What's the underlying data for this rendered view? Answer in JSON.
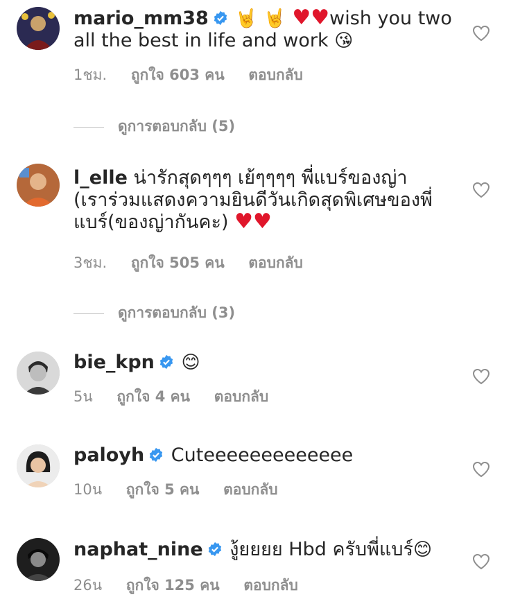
{
  "comments": [
    {
      "username": "mario_mm38",
      "verified": true,
      "text_suffix": "wish you two all the best in life and work",
      "time": "1ชม.",
      "likes": "ถูกใจ 603 คน",
      "reply": "ตอบกลับ"
    },
    {
      "username": "l_elle",
      "verified": false,
      "text": "น่ารักสุดๆๆๆ เย้ๆๆๆๆ พี่แบร์ของญ่า (เราร่วมแสดงความยินดีวันเกิดสุดพิเศษของพี่แบร์(ของญ่ากันคะ)",
      "time": "3ชม.",
      "likes": "ถูกใจ 505 คน",
      "reply": "ตอบกลับ"
    },
    {
      "username": "bie_kpn",
      "verified": true,
      "time": "5น",
      "likes": "ถูกใจ 4 คน",
      "reply": "ตอบกลับ"
    },
    {
      "username": "paloyh",
      "verified": true,
      "text": "Cuteeeeeeeeeeeee",
      "time": "10น",
      "likes": "ถูกใจ 5 คน",
      "reply": "ตอบกลับ"
    },
    {
      "username": "naphat_nine",
      "verified": true,
      "text": "งู้ยยยย Hbd ครับพี่แบร์",
      "time": "26น",
      "likes": "ถูกใจ 125 คน",
      "reply": "ตอบกลับ"
    }
  ],
  "view_replies": [
    "ดูการตอบกลับ (5)",
    "ดูการตอบกลับ (3)"
  ],
  "colors": {
    "text": "#262626",
    "meta": "#8e8e8e",
    "verified": "#3897f0",
    "heart_emoji": "#e0162b"
  },
  "icons": [
    "verified-badge-icon",
    "heart-outline-icon",
    "rock-hand-emoji",
    "red-heart-emoji",
    "kissing-face-emoji",
    "smiling-face-emoji"
  ]
}
